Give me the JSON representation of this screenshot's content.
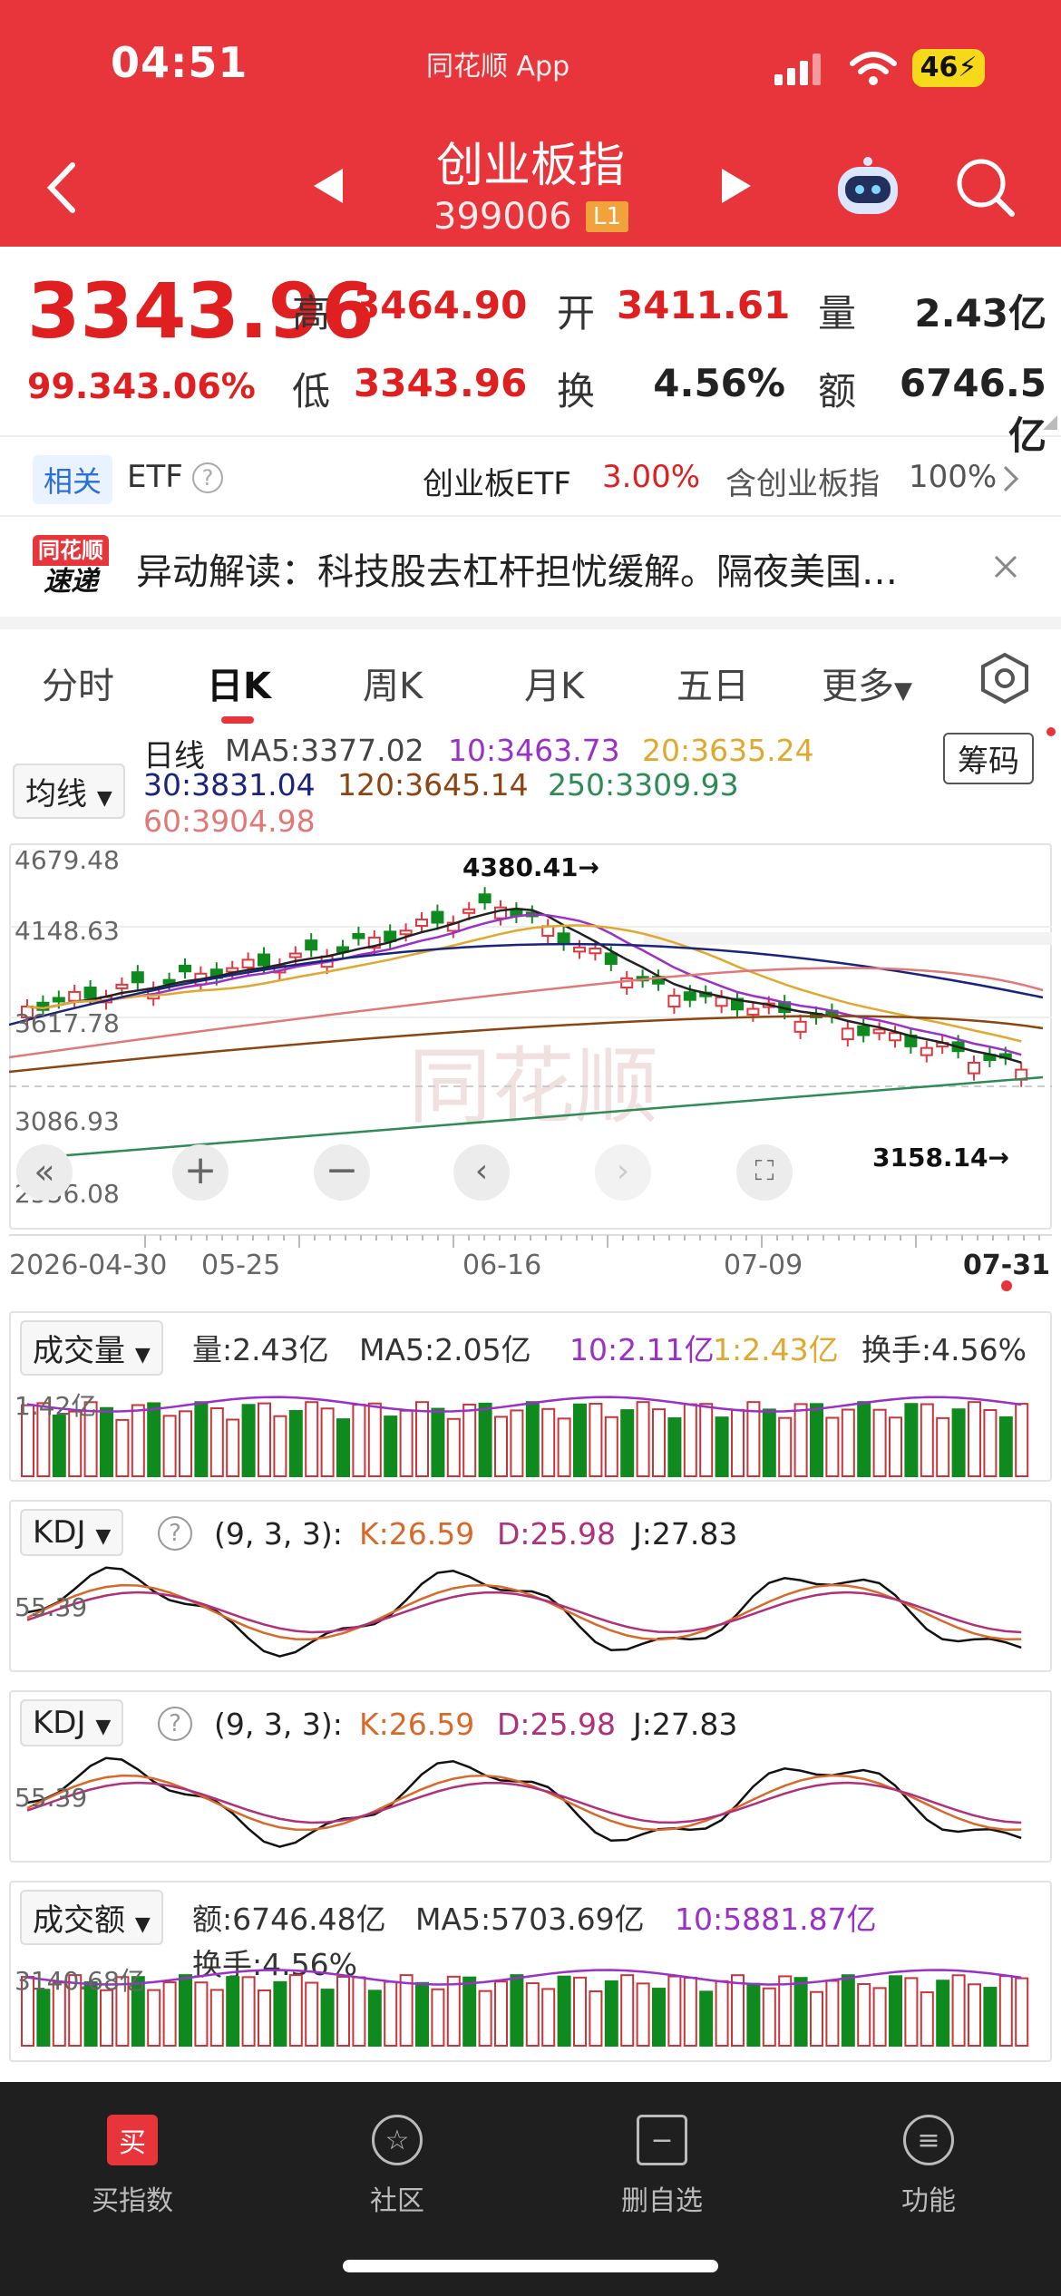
{
  "status": {
    "time": "04:51",
    "app": "同花顺 App",
    "battery": "46"
  },
  "header": {
    "title": "创业板指",
    "code": "399006",
    "level": "L1"
  },
  "quote": {
    "price": "3343.96",
    "change": "99.34",
    "change_pct": "3.06%",
    "high_label": "高",
    "high": "3464.90",
    "open_label": "开",
    "open": "3411.61",
    "volume_label": "量",
    "volume": "2.43亿",
    "low_label": "低",
    "low": "3343.96",
    "turnover_label": "换",
    "turnover": "4.56%",
    "amount_label": "额",
    "amount": "6746.5亿"
  },
  "etf": {
    "related": "相关",
    "etf": "ETF",
    "fund_name": "创业板ETF",
    "fund_pct": "3.00%",
    "contains": "含创业板指",
    "contains_pct": "100%"
  },
  "news": {
    "logo_top": "同花顺",
    "logo_bottom": "速递",
    "text": "异动解读：科技股去杠杆担忧缓解。隔夜美国…"
  },
  "tabs": [
    {
      "label": "分时"
    },
    {
      "label": "日K"
    },
    {
      "label": "周K"
    },
    {
      "label": "月K"
    },
    {
      "label": "五日"
    },
    {
      "label": "更多"
    }
  ],
  "kline": {
    "selector": "均线",
    "chip_button": "筹码",
    "ma_title": "日线",
    "ma5": "MA5:3377.02",
    "ma10": "10:3463.73",
    "ma20": "20:3635.24",
    "ma30": "30:3831.04",
    "ma120": "120:3645.14",
    "ma250": "250:3309.93",
    "ma60": "60:3904.98",
    "y_ticks": [
      "4679.48",
      "4148.63",
      "3617.78",
      "3086.93",
      "2556.08"
    ],
    "x_ticks": [
      "2026-04-30",
      "05-25",
      "06-16",
      "07-09",
      "07-31"
    ],
    "high_marker": "4380.41→",
    "low_marker": "3158.14→",
    "watermark": "同花顺",
    "colors": {
      "ma5": "#222222",
      "ma10": "#9b30c8",
      "ma20": "#e0a82e",
      "ma30": "#1a237e",
      "ma60": "#e07878",
      "ma120": "#8b4513",
      "ma250": "#2e8b57"
    }
  },
  "volume": {
    "selector": "成交量",
    "amount": "量:2.43亿",
    "ma5": "MA5:2.05亿",
    "ma10": "10:2.11亿",
    "ma1": "1:2.43亿",
    "turnover": "换手:4.56%",
    "axis": "1.42亿"
  },
  "kdj1": {
    "selector": "KDJ",
    "help": "?",
    "params": "(9, 3, 3):",
    "k": "K:26.59",
    "d": "D:25.98",
    "j": "J:27.83",
    "axis": "55.39"
  },
  "kdj2": {
    "selector": "KDJ",
    "help": "?",
    "params": "(9, 3, 3):",
    "k": "K:26.59",
    "d": "D:25.98",
    "j": "J:27.83",
    "axis": "55.39"
  },
  "amount": {
    "selector": "成交额",
    "amount": "额:6746.48亿",
    "ma5": "MA5:5703.69亿",
    "ma10": "10:5881.87亿",
    "turnover": "换手:4.56%",
    "axis": "3140.68亿"
  },
  "tabbar": [
    {
      "label": "买指数",
      "icon": "买"
    },
    {
      "label": "社区",
      "icon": "☆"
    },
    {
      "label": "删自选",
      "icon": "−"
    },
    {
      "label": "功能",
      "icon": "≡"
    }
  ]
}
